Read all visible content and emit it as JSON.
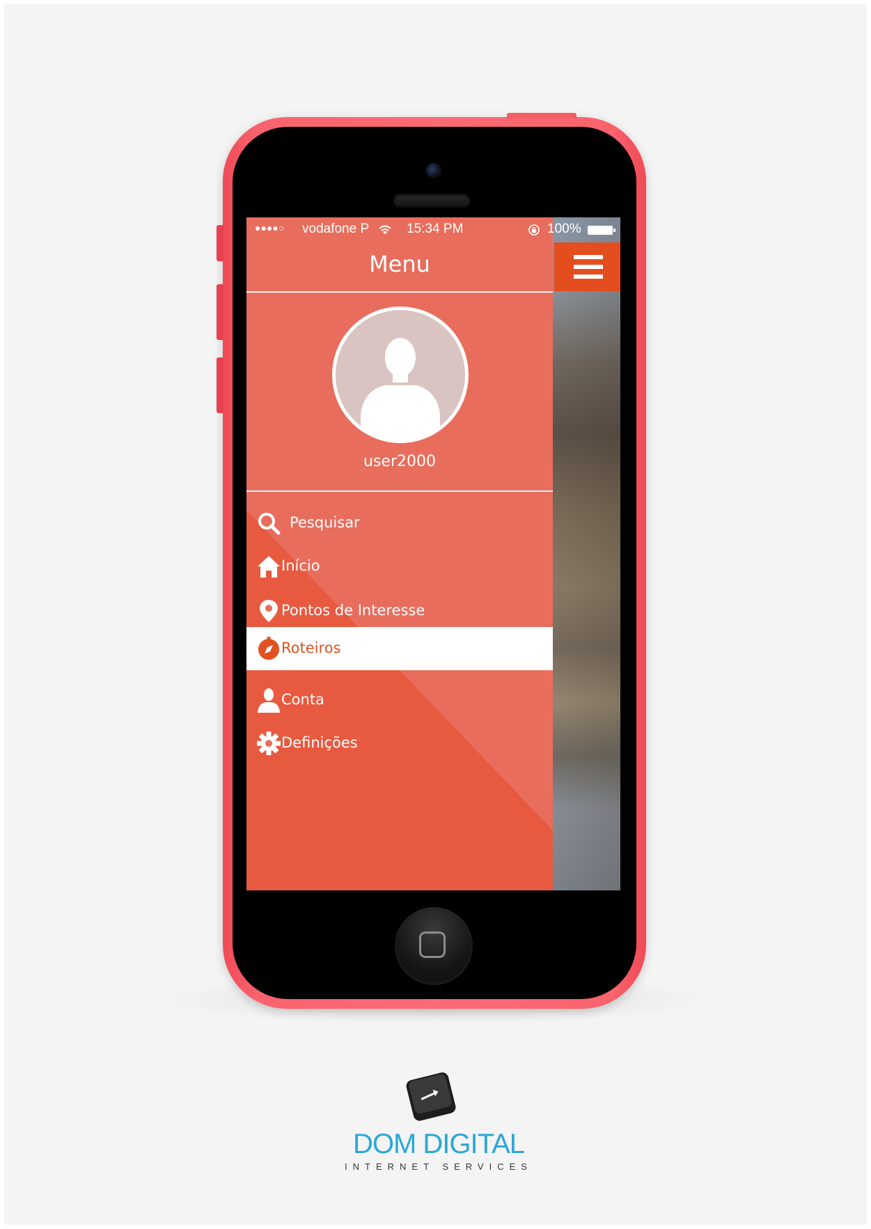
{
  "status_bar": {
    "signal": "●●●●○",
    "carrier": "vodafone P",
    "wifi_icon": "wifi-icon",
    "time": "15:34 PM",
    "lock_icon": "orientation-lock-icon",
    "battery_percent": "100%",
    "battery_level": 1.0
  },
  "header": {
    "title": "Menu",
    "menu_button_icon": "hamburger-icon"
  },
  "profile": {
    "avatar_icon": "user-silhouette-icon",
    "username": "user2000"
  },
  "menu": {
    "items": [
      {
        "label": "Pesquisar",
        "icon": "search-icon",
        "active": false
      },
      {
        "label": "Início",
        "icon": "home-icon",
        "active": false
      },
      {
        "label": "Pontos de Interesse",
        "icon": "map-pin-icon",
        "active": false
      },
      {
        "label": "Roteiros",
        "icon": "compass-icon",
        "active": true
      },
      {
        "label": "Conta",
        "icon": "user-icon",
        "active": false
      },
      {
        "label": "Definições",
        "icon": "gear-icon",
        "active": false
      }
    ]
  },
  "branding": {
    "logo_icon": "keyboard-key-arrow-icon",
    "name": "DOM DIGITAL",
    "tagline": "INTERNET SERVICES"
  },
  "colors": {
    "drawer": "#e96d5c",
    "accent": "#e44d1e",
    "phone_body": "#fb6b74",
    "logo_blue": "#2aa7d8"
  }
}
